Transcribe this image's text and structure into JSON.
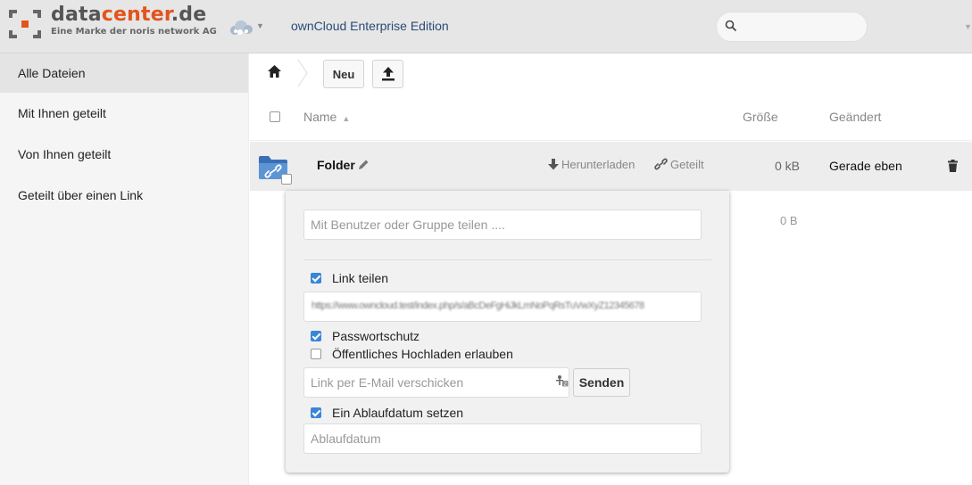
{
  "header": {
    "logo_part1": "data",
    "logo_part2": "center",
    "logo_part3": ".de",
    "logo_subtitle": "Eine Marke der noris network AG",
    "app_name": "ownCloud Enterprise Edition",
    "search_placeholder": ""
  },
  "sidebar": {
    "items": [
      {
        "label": "Alle Dateien"
      },
      {
        "label": "Mit Ihnen geteilt"
      },
      {
        "label": "Von Ihnen geteilt"
      },
      {
        "label": "Geteilt über einen Link"
      }
    ]
  },
  "controls": {
    "new_label": "Neu"
  },
  "table": {
    "col_name": "Name",
    "col_size": "Größe",
    "col_modified": "Geändert",
    "sort_indicator": "▲"
  },
  "file": {
    "name": "Folder",
    "download_label": "Herunterladen",
    "share_label": "Geteilt",
    "size": "0 kB",
    "modified": "Gerade eben"
  },
  "summary": {
    "size": "0 B"
  },
  "share": {
    "user_placeholder": "Mit Benutzer oder Gruppe teilen ....",
    "link_share_label": "Link teilen",
    "link_url": "https://www.owncloud.test/index.php/s/aBcDeFgHiJkLmNoPqRsTuVwXyZ12345678",
    "password_label": "Passwortschutz",
    "public_upload_label": "Öffentliches Hochladen erlauben",
    "email_placeholder": "Link per E-Mail verschicken",
    "send_label": "Senden",
    "expire_label": "Ein Ablaufdatum setzen",
    "expire_placeholder": "Ablaufdatum"
  },
  "colors": {
    "accent_orange": "#e2541c",
    "checkbox_blue": "#3a86d6",
    "header_bg": "#e6e6e6"
  }
}
